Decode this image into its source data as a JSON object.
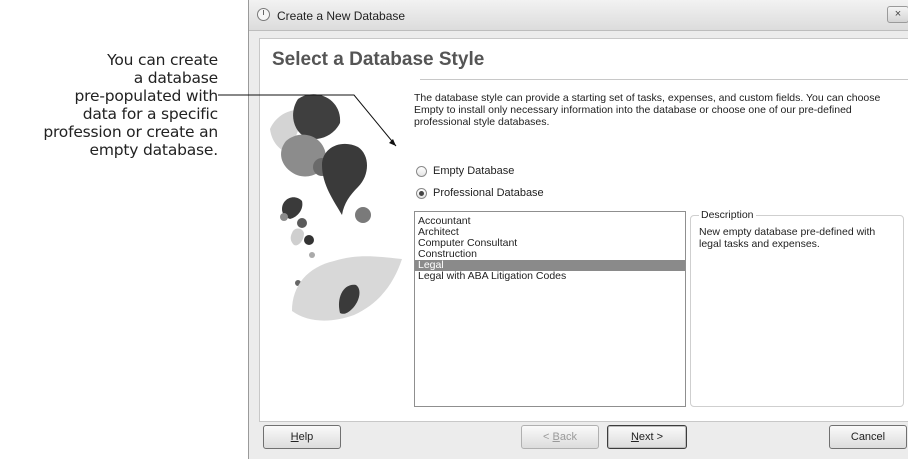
{
  "annotation": {
    "lines": [
      "You can create",
      "a database",
      "pre-populated with",
      "data for a specific",
      "profession or create an",
      "empty database."
    ]
  },
  "window": {
    "title": "Create a New Database",
    "close_glyph": "×"
  },
  "page": {
    "heading": "Select a Database Style",
    "description": "The database style can provide a starting set of tasks, expenses, and custom fields. You can choose Empty to install only necessary information into the database or choose one of our pre-defined professional style databases."
  },
  "options": {
    "empty": {
      "label": "Empty Database",
      "checked": false
    },
    "professional": {
      "label": "Professional Database",
      "checked": true
    }
  },
  "professions": {
    "items": [
      "Accountant",
      "Architect",
      "Computer Consultant",
      "Construction",
      "Legal",
      "Legal with ABA Litigation Codes"
    ],
    "selected": "Legal"
  },
  "description_box": {
    "label": "Description",
    "text": "New empty database pre-defined with legal tasks and expenses."
  },
  "buttons": {
    "help": {
      "mnemonic": "H",
      "rest": "elp"
    },
    "back": {
      "prefix": "< ",
      "mnemonic": "B",
      "rest": "ack"
    },
    "next": {
      "mnemonic": "N",
      "rest": "ext >"
    },
    "cancel": "Cancel"
  },
  "colors": {
    "selection": "#8a8a8a",
    "art_dark": "#3a3a3a",
    "art_mid": "#8c8c8c",
    "art_light": "#d0d0d0"
  }
}
